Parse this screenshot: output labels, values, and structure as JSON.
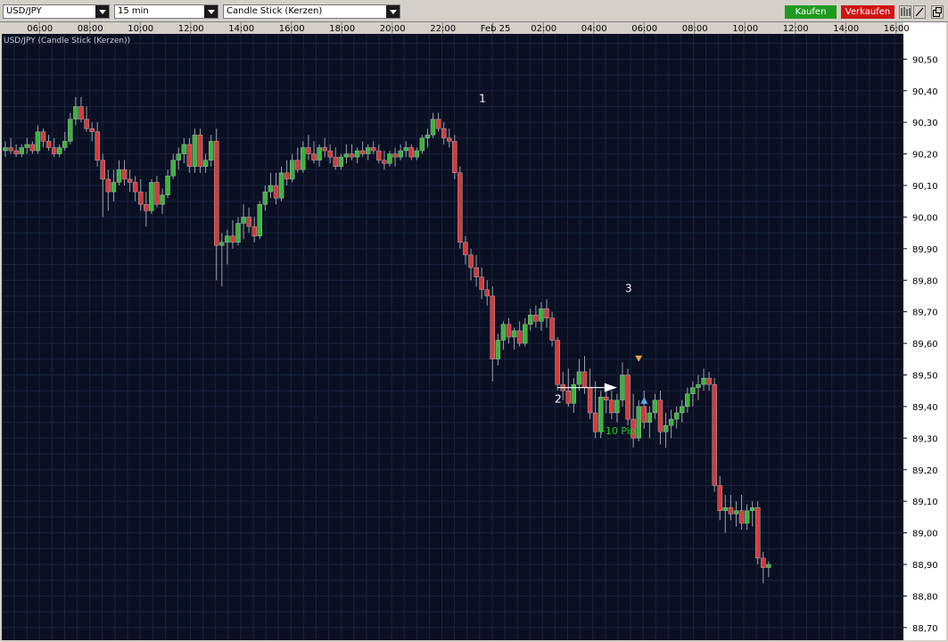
{
  "toolbar": {
    "symbol": "USD/JPY",
    "interval": "15 min",
    "chart_style": "Candle Stick (Kerzen)",
    "buy_label": "Kaufen",
    "sell_label": "Verkaufen",
    "buy_color": "#1f9a1f",
    "sell_color": "#d11414",
    "icons": [
      "candle-type-icon",
      "draw-line-icon",
      "detach-window-icon"
    ]
  },
  "chart_data": {
    "type": "candlestick",
    "title": "USD/JPY (Candle Stick (Kerzen))",
    "grid": true,
    "background": "#0a1022",
    "up_color": "#3cb43c",
    "down_color": "#d43c3c",
    "x_ticks": [
      "06:00",
      "08:00",
      "10:00",
      "12:00",
      "14:00",
      "16:00",
      "18:00",
      "20:00",
      "22:00",
      "Feb 25",
      "02:00",
      "04:00",
      "06:00",
      "08:00",
      "10:00",
      "12:00",
      "14:00",
      "16:00"
    ],
    "y_ticks": [
      "90,50",
      "90,40",
      "90,30",
      "90,20",
      "90,10",
      "90,00",
      "89,90",
      "89,80",
      "89,70",
      "89,60",
      "89,50",
      "89,40",
      "89,30",
      "89,20",
      "89,10",
      "89,00",
      "88,90",
      "88,80",
      "88,70"
    ],
    "ylim": [
      88.66,
      90.58
    ],
    "candles_ohlc": [
      [
        90.21,
        90.24,
        90.19,
        90.22
      ],
      [
        90.22,
        90.25,
        90.2,
        90.21
      ],
      [
        90.21,
        90.23,
        90.19,
        90.2
      ],
      [
        90.2,
        90.23,
        90.19,
        90.22
      ],
      [
        90.22,
        90.25,
        90.2,
        90.23
      ],
      [
        90.23,
        90.24,
        90.2,
        90.21
      ],
      [
        90.21,
        90.29,
        90.2,
        90.27
      ],
      [
        90.27,
        90.28,
        90.22,
        90.24
      ],
      [
        90.24,
        90.26,
        90.21,
        90.22
      ],
      [
        90.22,
        90.25,
        90.19,
        90.2
      ],
      [
        90.2,
        90.23,
        90.19,
        90.22
      ],
      [
        90.22,
        90.27,
        90.21,
        90.24
      ],
      [
        90.24,
        90.33,
        90.23,
        90.31
      ],
      [
        90.31,
        90.38,
        90.29,
        90.35
      ],
      [
        90.35,
        90.38,
        90.3,
        90.31
      ],
      [
        90.31,
        90.35,
        90.27,
        90.28
      ],
      [
        90.28,
        90.3,
        90.24,
        90.27
      ],
      [
        90.27,
        90.3,
        90.16,
        90.18
      ],
      [
        90.18,
        90.2,
        90.0,
        90.12
      ],
      [
        90.12,
        90.15,
        90.02,
        90.08
      ],
      [
        90.08,
        90.15,
        90.05,
        90.11
      ],
      [
        90.11,
        90.18,
        90.1,
        90.15
      ],
      [
        90.15,
        90.18,
        90.1,
        90.12
      ],
      [
        90.12,
        90.15,
        90.08,
        90.11
      ],
      [
        90.11,
        90.13,
        90.05,
        90.08
      ],
      [
        90.08,
        90.12,
        90.02,
        90.04
      ],
      [
        90.04,
        90.08,
        89.97,
        90.02
      ],
      [
        90.02,
        90.12,
        90.01,
        90.11
      ],
      [
        90.11,
        90.13,
        90.03,
        90.04
      ],
      [
        90.04,
        90.09,
        90.01,
        90.07
      ],
      [
        90.07,
        90.15,
        90.06,
        90.13
      ],
      [
        90.13,
        90.2,
        90.12,
        90.18
      ],
      [
        90.18,
        90.22,
        90.15,
        90.2
      ],
      [
        90.2,
        90.25,
        90.17,
        90.23
      ],
      [
        90.23,
        90.25,
        90.14,
        90.16
      ],
      [
        90.16,
        90.28,
        90.14,
        90.26
      ],
      [
        90.26,
        90.28,
        90.14,
        90.16
      ],
      [
        90.16,
        90.2,
        90.14,
        90.18
      ],
      [
        90.18,
        90.26,
        90.16,
        90.24
      ],
      [
        90.24,
        90.28,
        89.8,
        89.91
      ],
      [
        89.91,
        89.95,
        89.78,
        89.92
      ],
      [
        89.92,
        89.96,
        89.85,
        89.94
      ],
      [
        89.94,
        89.99,
        89.9,
        89.92
      ],
      [
        89.92,
        90.0,
        89.91,
        89.98
      ],
      [
        89.98,
        90.04,
        89.93,
        90.0
      ],
      [
        90.0,
        90.03,
        89.95,
        89.97
      ],
      [
        89.97,
        90.0,
        89.92,
        89.94
      ],
      [
        89.94,
        90.05,
        89.93,
        90.04
      ],
      [
        90.04,
        90.1,
        90.02,
        90.08
      ],
      [
        90.08,
        90.14,
        90.06,
        90.1
      ],
      [
        90.1,
        90.14,
        90.04,
        90.06
      ],
      [
        90.06,
        90.16,
        90.05,
        90.14
      ],
      [
        90.14,
        90.18,
        90.1,
        90.12
      ],
      [
        90.12,
        90.2,
        90.11,
        90.18
      ],
      [
        90.18,
        90.22,
        90.14,
        90.15
      ],
      [
        90.15,
        90.24,
        90.14,
        90.22
      ],
      [
        90.22,
        90.26,
        90.18,
        90.2
      ],
      [
        90.2,
        90.24,
        90.17,
        90.18
      ],
      [
        90.18,
        90.23,
        90.16,
        90.22
      ],
      [
        90.22,
        90.25,
        90.19,
        90.21
      ],
      [
        90.21,
        90.23,
        90.17,
        90.19
      ],
      [
        90.19,
        90.22,
        90.15,
        90.16
      ],
      [
        90.16,
        90.2,
        90.15,
        90.19
      ],
      [
        90.19,
        90.23,
        90.17,
        90.2
      ],
      [
        90.2,
        90.23,
        90.18,
        90.19
      ],
      [
        90.19,
        90.22,
        90.17,
        90.21
      ],
      [
        90.21,
        90.24,
        90.19,
        90.2
      ],
      [
        90.2,
        90.23,
        90.18,
        90.22
      ],
      [
        90.22,
        90.24,
        90.2,
        90.21
      ],
      [
        90.21,
        90.23,
        90.17,
        90.18
      ],
      [
        90.18,
        90.21,
        90.15,
        90.17
      ],
      [
        90.17,
        90.21,
        90.16,
        90.2
      ],
      [
        90.2,
        90.22,
        90.16,
        90.19
      ],
      [
        90.19,
        90.23,
        90.18,
        90.21
      ],
      [
        90.21,
        90.24,
        90.19,
        90.22
      ],
      [
        90.22,
        90.23,
        90.18,
        90.19
      ],
      [
        90.19,
        90.22,
        90.18,
        90.21
      ],
      [
        90.21,
        90.26,
        90.2,
        90.25
      ],
      [
        90.25,
        90.28,
        90.22,
        90.26
      ],
      [
        90.26,
        90.33,
        90.25,
        90.31
      ],
      [
        90.31,
        90.33,
        90.27,
        90.28
      ],
      [
        90.28,
        90.3,
        90.23,
        90.25
      ],
      [
        90.25,
        90.28,
        90.22,
        90.24
      ],
      [
        90.24,
        90.26,
        90.12,
        90.14
      ],
      [
        90.14,
        90.16,
        89.9,
        89.92
      ],
      [
        89.92,
        89.94,
        89.85,
        89.88
      ],
      [
        89.88,
        89.9,
        89.8,
        89.84
      ],
      [
        89.84,
        89.88,
        89.78,
        89.81
      ],
      [
        89.81,
        89.84,
        89.74,
        89.77
      ],
      [
        89.77,
        89.8,
        89.72,
        89.75
      ],
      [
        89.75,
        89.78,
        89.48,
        89.55
      ],
      [
        89.55,
        89.63,
        89.53,
        89.61
      ],
      [
        89.61,
        89.67,
        89.58,
        89.66
      ],
      [
        89.66,
        89.68,
        89.6,
        89.62
      ],
      [
        89.62,
        89.65,
        89.58,
        89.64
      ],
      [
        89.64,
        89.67,
        89.59,
        89.6
      ],
      [
        89.6,
        89.68,
        89.59,
        89.66
      ],
      [
        89.66,
        89.71,
        89.64,
        89.69
      ],
      [
        89.69,
        89.72,
        89.65,
        89.67
      ],
      [
        89.67,
        89.73,
        89.64,
        89.71
      ],
      [
        89.71,
        89.74,
        89.65,
        89.68
      ],
      [
        89.68,
        89.7,
        89.59,
        89.61
      ],
      [
        89.61,
        89.62,
        89.45,
        89.47
      ],
      [
        89.47,
        89.51,
        89.42,
        89.45
      ],
      [
        89.45,
        89.52,
        89.4,
        89.41
      ],
      [
        89.41,
        89.49,
        89.38,
        89.47
      ],
      [
        89.47,
        89.55,
        89.45,
        89.51
      ],
      [
        89.51,
        89.56,
        89.44,
        89.46
      ],
      [
        89.46,
        89.52,
        89.36,
        89.38
      ],
      [
        89.38,
        89.48,
        89.3,
        89.32
      ],
      [
        89.32,
        89.45,
        89.3,
        89.43
      ],
      [
        89.43,
        89.46,
        89.38,
        89.42
      ],
      [
        89.42,
        89.45,
        89.36,
        89.38
      ],
      [
        89.38,
        89.44,
        89.35,
        89.42
      ],
      [
        89.42,
        89.54,
        89.4,
        89.5
      ],
      [
        89.5,
        89.52,
        89.34,
        89.36
      ],
      [
        89.36,
        89.44,
        89.27,
        89.3
      ],
      [
        89.3,
        89.42,
        89.29,
        89.4
      ],
      [
        89.4,
        89.45,
        89.33,
        89.35
      ],
      [
        89.35,
        89.4,
        89.3,
        89.38
      ],
      [
        89.38,
        89.44,
        89.36,
        89.42
      ],
      [
        89.42,
        89.45,
        89.28,
        89.32
      ],
      [
        89.32,
        89.38,
        89.27,
        89.34
      ],
      [
        89.34,
        89.39,
        89.3,
        89.36
      ],
      [
        89.36,
        89.4,
        89.33,
        89.38
      ],
      [
        89.38,
        89.42,
        89.35,
        89.4
      ],
      [
        89.4,
        89.46,
        89.38,
        89.44
      ],
      [
        89.44,
        89.48,
        89.4,
        89.46
      ],
      [
        89.46,
        89.5,
        89.42,
        89.47
      ],
      [
        89.47,
        89.52,
        89.45,
        89.49
      ],
      [
        89.49,
        89.51,
        89.45,
        89.47
      ],
      [
        89.47,
        89.49,
        89.13,
        89.15
      ],
      [
        89.15,
        89.18,
        89.04,
        89.07
      ],
      [
        89.07,
        89.12,
        89.0,
        89.08
      ],
      [
        89.08,
        89.12,
        89.04,
        89.06
      ],
      [
        89.06,
        89.1,
        89.02,
        89.07
      ],
      [
        89.07,
        89.12,
        89.01,
        89.03
      ],
      [
        89.03,
        89.09,
        89.01,
        89.07
      ],
      [
        89.07,
        89.1,
        89.02,
        89.08
      ],
      [
        89.08,
        89.1,
        88.9,
        88.92
      ],
      [
        88.92,
        88.94,
        88.84,
        88.89
      ],
      [
        88.89,
        88.91,
        88.86,
        88.9
      ]
    ],
    "annotations": [
      {
        "text": "1",
        "color": "#ffffff"
      },
      {
        "text": "2",
        "color": "#ffffff"
      },
      {
        "text": "3",
        "color": "#ffffff"
      },
      {
        "text": "+10 Pips",
        "color": "#22cc22"
      }
    ]
  }
}
